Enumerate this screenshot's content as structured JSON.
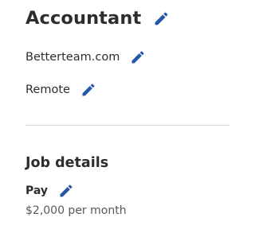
{
  "header": {
    "job_title": "Accountant",
    "company": "Betterteam.com",
    "location": "Remote"
  },
  "job_details": {
    "heading": "Job details",
    "pay_label": "Pay",
    "pay_value": "$2,000 per month"
  },
  "icons": {
    "edit": "pencil-icon"
  },
  "colors": {
    "text": "#2d2d2d",
    "secondary_text": "#595959",
    "edit_icon": "#2557a7",
    "divider": "#dcdcdc"
  }
}
